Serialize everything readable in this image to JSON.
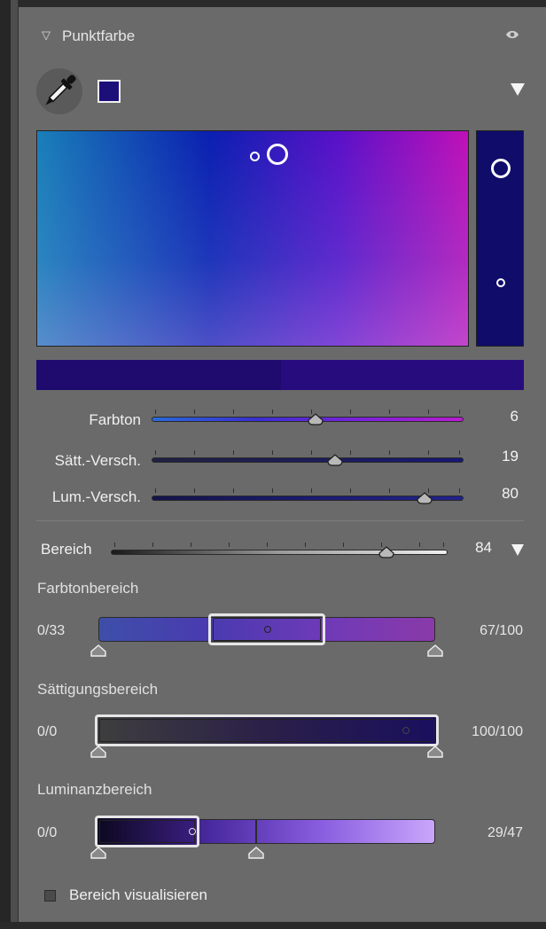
{
  "header": {
    "title": "Punktfarbe",
    "icons": [
      "collapse-triangle-icon",
      "eye-icon"
    ]
  },
  "tools": {
    "picker_icon": "eyedropper-icon",
    "swatch_color": "#1d0f7a",
    "menu_icon": "triangle-down-icon"
  },
  "sliders": [
    {
      "label": "Farbton",
      "value": "6"
    },
    {
      "label": "Sätt.-Versch.",
      "value": "19"
    },
    {
      "label": "Lum.-Versch.",
      "value": "80"
    }
  ],
  "bereich": {
    "label": "Bereich",
    "value": "84"
  },
  "hue_range": {
    "title": "Farbtonbereich",
    "left": "0/33",
    "right": "67/100"
  },
  "sat_range": {
    "title": "Sättigungsbereich",
    "left": "0/0",
    "right": "100/100"
  },
  "lum_range": {
    "title": "Luminanzbereich",
    "left": "0/0",
    "right": "29/47"
  },
  "visualize": {
    "label": "Bereich visualisieren",
    "checked": false
  }
}
